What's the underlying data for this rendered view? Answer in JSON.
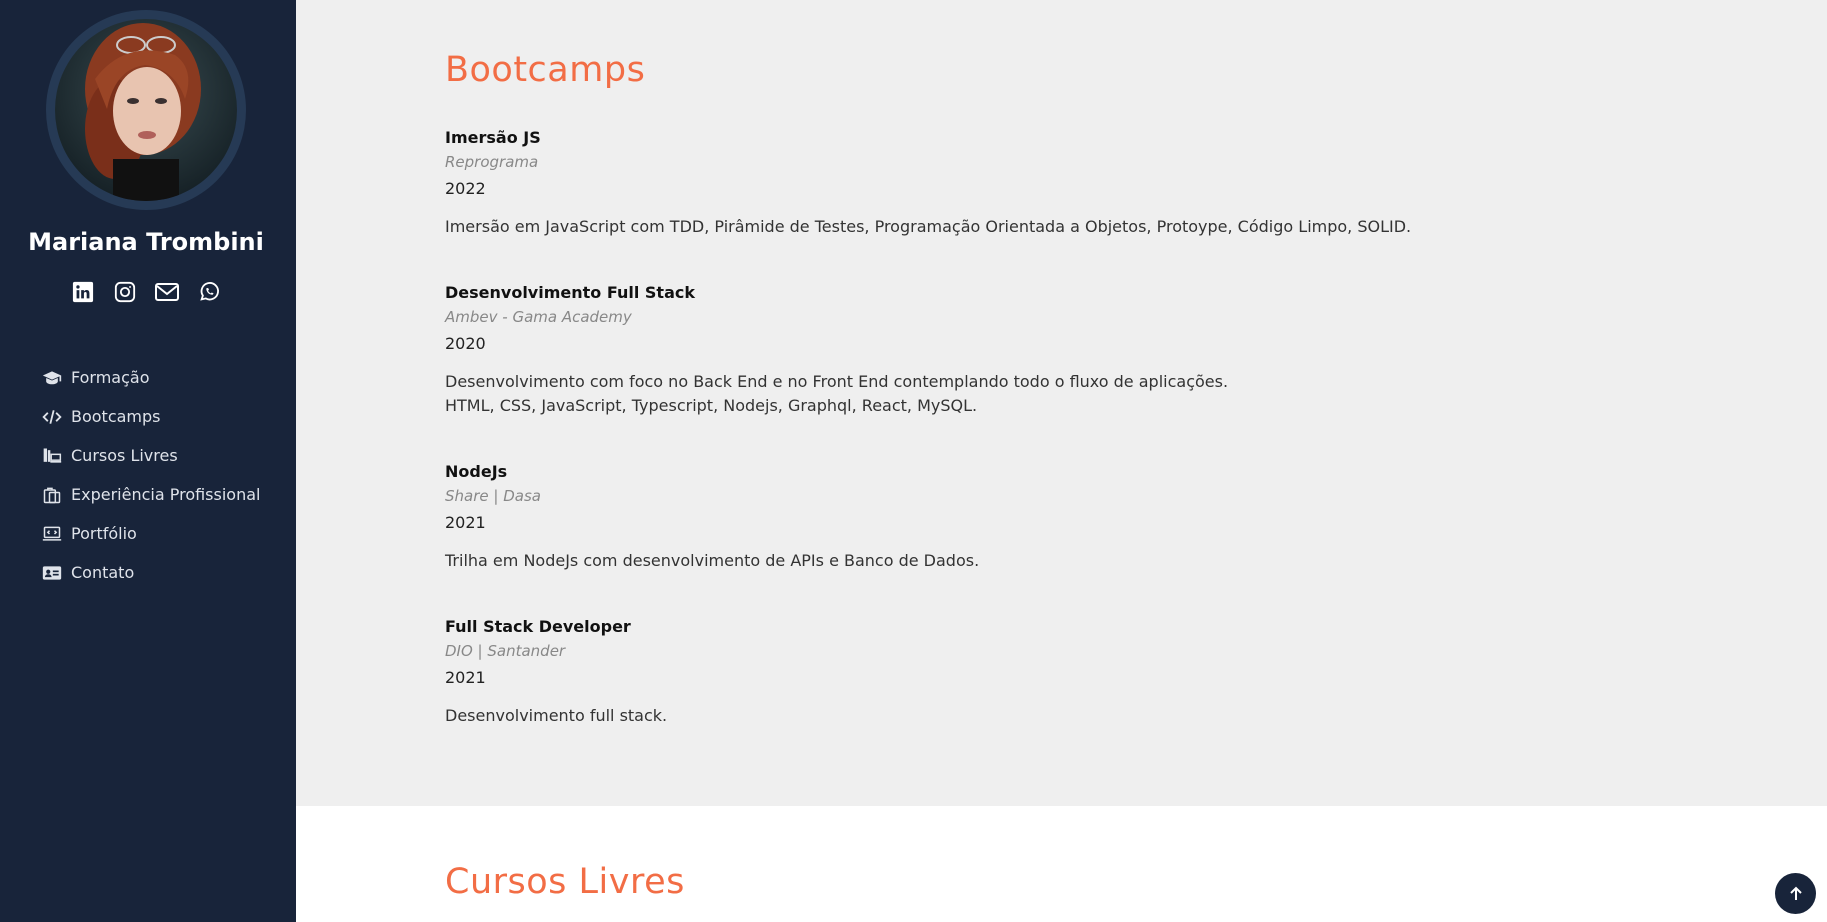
{
  "profile": {
    "name": "Mariana Trombini"
  },
  "social": [
    {
      "icon": "linkedin-icon"
    },
    {
      "icon": "instagram-icon"
    },
    {
      "icon": "email-icon"
    },
    {
      "icon": "whatsapp-icon"
    }
  ],
  "nav": {
    "items": [
      {
        "label": "Formação",
        "icon": "graduation-cap-icon"
      },
      {
        "label": "Bootcamps",
        "icon": "code-icon"
      },
      {
        "label": "Cursos Livres",
        "icon": "laptop-books-icon"
      },
      {
        "label": "Experiência Profissional",
        "icon": "clipboard-icon"
      },
      {
        "label": "Portfólio",
        "icon": "laptop-code-icon"
      },
      {
        "label": "Contato",
        "icon": "id-card-icon"
      }
    ]
  },
  "bootcamps": {
    "title": "Bootcamps",
    "entries": [
      {
        "title": "Imersão JS",
        "org": "Reprograma",
        "year": "2022",
        "desc1": "Imersão em JavaScript com TDD, Pirâmide de Testes, Programação Orientada a Objetos, Protoype, Código Limpo, SOLID.",
        "desc2": ""
      },
      {
        "title": "Desenvolvimento Full Stack",
        "org": "Ambev - Gama Academy",
        "year": "2020",
        "desc1": "Desenvolvimento com foco no Back End e no Front End contemplando todo o fluxo de aplicações.",
        "desc2": "HTML, CSS, JavaScript, Typescript, Nodejs, Graphql, React, MySQL."
      },
      {
        "title": "NodeJs",
        "org": "Share | Dasa",
        "year": "2021",
        "desc1": "Trilha em NodeJs com desenvolvimento de APIs e Banco de Dados.",
        "desc2": ""
      },
      {
        "title": "Full Stack Developer",
        "org": "DIO | Santander",
        "year": "2021",
        "desc1": "Desenvolvimento full stack.",
        "desc2": ""
      }
    ]
  },
  "cursos": {
    "title": "Cursos Livres"
  },
  "colors": {
    "sidebar": "#18243a",
    "accent": "#f26d45",
    "background": "#efefef"
  },
  "back_to_top": {
    "icon": "arrow-up-icon"
  }
}
